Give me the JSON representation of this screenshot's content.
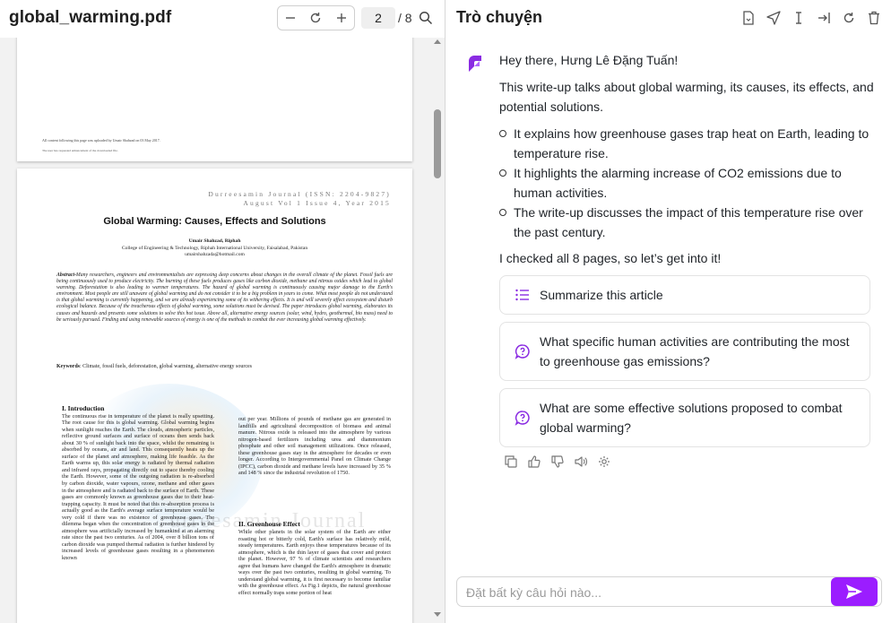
{
  "pdf": {
    "file_name": "global_warming.pdf",
    "current_page": "2",
    "total_pages": "/ 8",
    "page1_footer_line1": "All content following this page was uploaded by Umair Shahzad on 03 May 2017.",
    "page1_footer_line2": "The user has requested enhancement of the downloaded file.",
    "journal_line1": "Durreesamin Journal (ISSN: 2204-9827)",
    "journal_line2": "August Vol 1 Issue 4, Year 2015",
    "paper_title": "Global Warming: Causes, Effects and Solutions",
    "author_name": "Umair Shahzad, Riphah",
    "author_affil": "College of Engineering & Technology, Riphah International University, Faisalabad, Pakistan",
    "author_email": "umairshahzada@hotmail.com",
    "abstract_label": "Abstract-",
    "abstract_text": "Many researchers, engineers and environmentalists are expressing deep concerns about changes in the overall climate of the planet. Fossil fuels are being continuously used to produce electricity. The burning of these fuels produces gases like carbon dioxide, methane and nitrous oxides which lead to global warming. Deforestation is also leading to warmer temperatures. The hazard of global warming is continuously causing major damage to the Earth's environment. Most people are still unaware of global warming and do not consider it to be a big problem in years to come. What most people do not understand is that global warming is currently happening, and we are already experiencing some of its withering effects. It is and will severely affect ecosystem and disturb ecological balance. Because of the treacherous effects of global warming, some solutions must be devised. The paper introduces global warming, elaborates its causes and hazards and presents some solutions to solve this hot issue. Above all, alternative energy sources (solar, wind, hydro, geothermal, bio mass) need to be seriously pursued. Finding and using renewable sources of energy is one of the methods to combat the ever increasing global warming effectively.",
    "keywords_label": "Keywords",
    "keywords_text": ": Climate, fossil fuels, deforestation, global warming, alternative energy sources",
    "watermark": "urreesamin Journal",
    "section1_heading": "I. Introduction",
    "section1_text": "The continuous rise in temperature of the planet is really upsetting. The root cause for this is global warming. Global warming begins when sunlight reaches the Earth. The clouds, atmospheric particles, reflective ground surfaces and surface of oceans then sends back about 30 % of sunlight back into the space, whilst the remaining is absorbed by oceans, air and land. This consequently heats up the surface of the planet and atmosphere, making life feasible. As the Earth warms up, this solar energy is radiated by thermal radiation and infrared rays, propagating directly out to space thereby cooling the Earth. However, some of the outgoing radiation is re-absorbed by carbon dioxide, water vapours, ozone, methane and other gases in the atmosphere and is radiated back to the surface of Earth. These gases are commonly known as greenhouse gases due to their heat-trapping capacity. It must be noted that this re-absorption process is actually good as the Earth's average surface temperature would be very cold if there was no existence of greenhouse gases. The dilemma began when the concentration of greenhouse gases in the atmosphere was artificially increased by humankind at an alarming rate since the past two centuries. As of 2004, over 8 billion tons of carbon dioxide was pumped thermal radiation is further hindered by increased levels of greenhouse gases resulting in a phenomenon known",
    "col2_top_text": "out per year. Millions of pounds of methane gas are generated in landfills and agricultural decomposition of biomass and animal manure. Nitrous oxide is released into the atmosphere by various nitrogen-based fertilizers including urea and diammonium phosphate and other soil management utilizations. Once released, these greenhouse gases stay in the atmosphere for decades or even longer. According to Intergovernmental Panel on Climate Change (IPCC), carbon dioxide and methane levels have increased by 35 % and 148 % since the industrial revolution of 1750.",
    "section2_heading": "II. Greenhouse Effect",
    "section2_text": "While other planets in the solar system of the Earth are either roasting hot or bitterly cold, Earth's surface has relatively mild, steady temperatures. Earth enjoys these temperatures because of its atmosphere, which is the thin layer of gases that cover and protect the planet. However, 97 % of climate scientists and researchers agree that humans have changed the Earth's atmosphere in dramatic ways over the past two centuries, resulting in global warming. To understand global warming, it is first necessary to become familiar with the greenhouse effect. As Fig.1 depicts, the natural greenhouse effect normally traps some portion of heat"
  },
  "chat": {
    "title": "Trò chuyện",
    "greeting": "Hey there, Hưng Lê Đặng Tuấn!",
    "intro": "This write-up talks about global warming, its causes, its effects, and potential solutions.",
    "bullets": [
      "It explains how greenhouse gases trap heat on Earth, leading to temperature rise.",
      "It highlights the alarming increase of CO2 emissions due to human activities.",
      "The write-up discusses the impact of this temperature rise over the past century."
    ],
    "checked": "I checked all 8 pages, so let’s get into it!",
    "suggestions": [
      "Summarize this article",
      "What specific human activities are contributing the most to greenhouse gas emissions?",
      "What are some effective solutions proposed to combat global warming?"
    ],
    "input_placeholder": "Đặt bất kỳ câu hỏi nào..."
  },
  "colors": {
    "accent": "#9b1dff",
    "suggestion_icon": "#8a2be2"
  },
  "icons": [
    "zoom-out-icon",
    "rotate-icon",
    "zoom-in-icon",
    "search-icon",
    "file-icon",
    "send-icon",
    "text-cursor-icon",
    "export-icon",
    "refresh-icon",
    "trash-icon",
    "list-icon",
    "question-bubble-icon",
    "copy-icon",
    "thumbs-up-icon",
    "thumbs-down-icon",
    "speaker-icon",
    "settings-icon"
  ]
}
